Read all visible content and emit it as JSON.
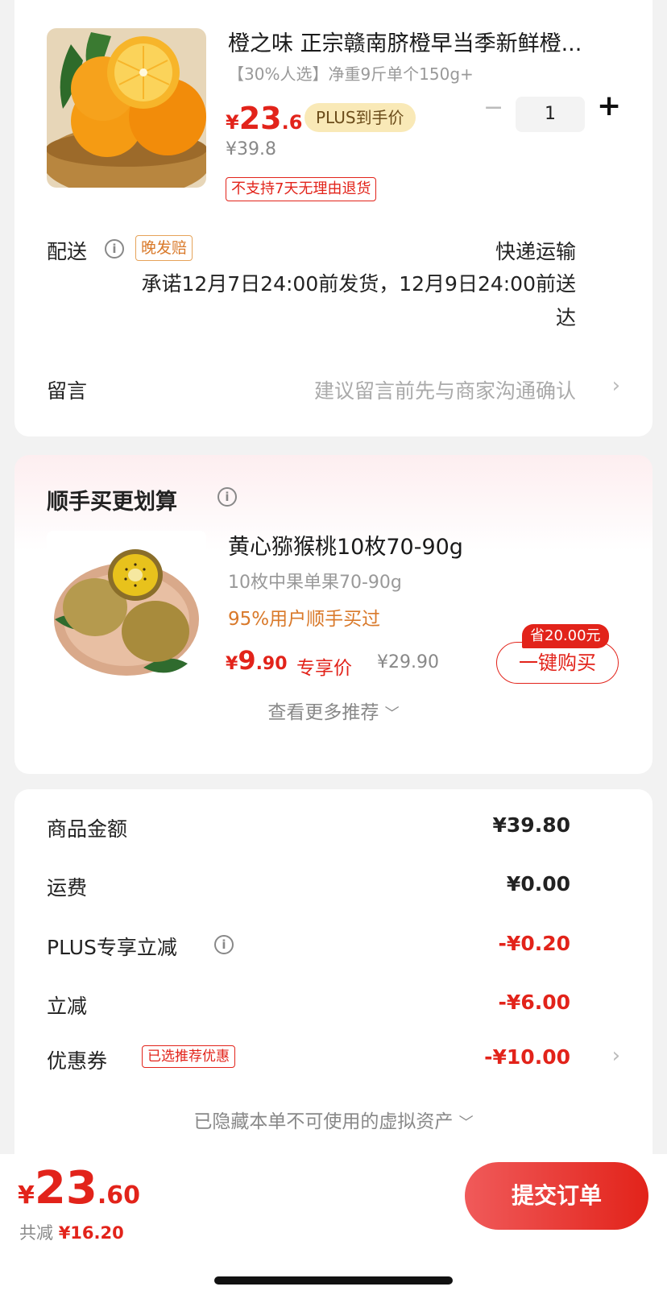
{
  "product": {
    "title": "橙之味 正宗赣南脐橙早当季新鲜橙...",
    "subtitle": "【30%人选】净重9斤单个150g+",
    "price_currency": "¥",
    "price_int": "23",
    "price_dec": ".6",
    "plus_tag": "PLUS到手价",
    "original_price": "¥39.8",
    "quantity": "1",
    "minus_label": "−",
    "plus_label": "+",
    "return_policy": "不支持7天无理由退货"
  },
  "delivery": {
    "label": "配送",
    "late_tag": "晚发赔",
    "method": "快递运输",
    "promise": "承诺12月7日24:00前发货，12月9日24:00前送达"
  },
  "message": {
    "label": "留言",
    "hint": "建议留言前先与商家沟通确认"
  },
  "recommend": {
    "title": "顺手买更划算",
    "name": "黄心猕猴桃10枚70-90g",
    "spec": "10枚中果单果70-90g",
    "popularity": "95%用户顺手买过",
    "price_currency": "¥",
    "price_int": "9",
    "price_dec": ".90",
    "exclusive_label": "专享价",
    "original_price": "¥29.90",
    "save_badge": "省20.00元",
    "buy_button": "一键购买",
    "more": "查看更多推荐"
  },
  "summary": {
    "rows": [
      {
        "label": "商品金额",
        "value": "¥39.80"
      },
      {
        "label": "运费",
        "value": "¥0.00"
      },
      {
        "label": "PLUS专享立减",
        "value": "-¥0.20"
      },
      {
        "label": "立减",
        "value": "-¥6.00"
      },
      {
        "label": "优惠券",
        "value": "-¥10.00"
      }
    ],
    "coupon_tag": "已选推荐优惠",
    "hidden_assets": "已隐藏本单不可使用的虚拟资产"
  },
  "bottom": {
    "total_currency": "¥",
    "total_int": "23",
    "total_dec": ".60",
    "saved_label": "共减",
    "saved_value": "¥16.20",
    "submit": "提交订单"
  },
  "colors": {
    "accent": "#e2231a",
    "orange": "#d9792a",
    "plus_gold": "#f9e9b7"
  }
}
